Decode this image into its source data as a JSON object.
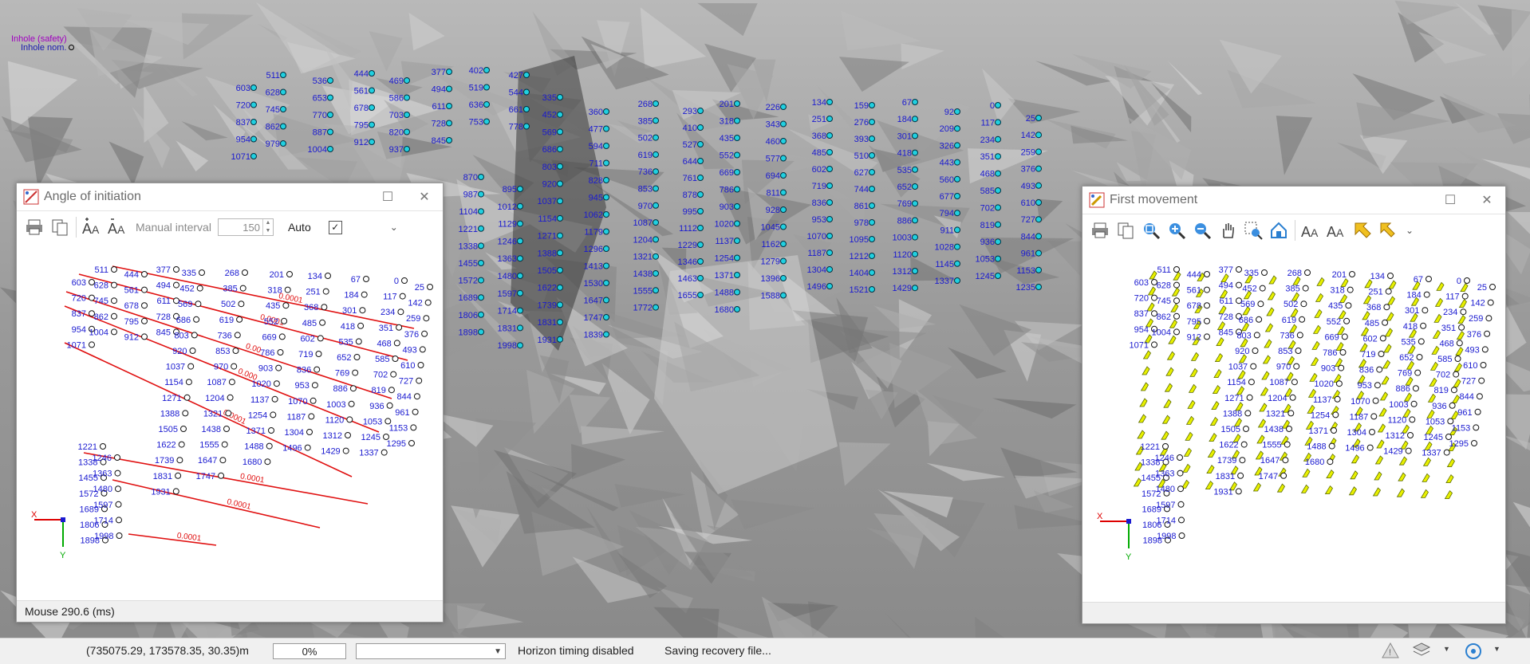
{
  "legend": {
    "line1": "Inhole (safety)",
    "line2": "Inhole nom."
  },
  "scene_labels": [
    [
      603,
      720,
      837,
      954,
      1071
    ],
    [
      511,
      628,
      745,
      862,
      979
    ],
    [
      536,
      653,
      770,
      887,
      1004
    ],
    [
      444,
      561,
      678,
      795,
      912
    ],
    [
      469,
      586,
      703,
      820,
      937
    ],
    [
      377,
      494,
      611,
      728,
      845
    ],
    [
      402,
      519,
      636,
      753
    ],
    [
      427,
      544,
      661,
      778
    ],
    [
      335,
      452,
      569,
      686,
      803,
      920,
      1037,
      1154,
      1271,
      1388,
      1505,
      1622,
      1739,
      1831,
      1931
    ],
    [
      360,
      477,
      594,
      711,
      828,
      945,
      1062,
      1179,
      1296,
      1413,
      1530,
      1647,
      1747,
      1839
    ],
    [
      268,
      385,
      502,
      619,
      736,
      853,
      970,
      1087,
      1204,
      1321,
      1438,
      1555,
      1772
    ],
    [
      293,
      410,
      527,
      644,
      761,
      878,
      995,
      1112,
      1229,
      1346,
      1463,
      1655
    ],
    [
      201,
      318,
      435,
      552,
      669,
      786,
      903,
      1020,
      1137,
      1254,
      1371,
      1488,
      1680
    ],
    [
      226,
      343,
      460,
      577,
      694,
      811,
      928,
      1045,
      1162,
      1279,
      1396,
      1588
    ],
    [
      134,
      251,
      368,
      485,
      602,
      719,
      836,
      953,
      1070,
      1187,
      1304,
      1496
    ],
    [
      159,
      276,
      393,
      510,
      627,
      744,
      861,
      978,
      1095,
      1212,
      1404,
      1521
    ],
    [
      67,
      184,
      301,
      418,
      535,
      652,
      769,
      886,
      1003,
      1120,
      1312,
      1429
    ],
    [
      92,
      209,
      326,
      443,
      560,
      677,
      794,
      911,
      1028,
      1145,
      1337
    ],
    [
      0,
      117,
      234,
      351,
      468,
      585,
      702,
      819,
      936,
      1053,
      1245
    ],
    [
      25,
      142,
      259,
      376,
      493,
      610,
      727,
      844,
      961,
      1153,
      1235
    ],
    [
      870,
      987,
      1104,
      1221,
      1338,
      1455,
      1572,
      1689,
      1806,
      1898
    ],
    [
      895,
      1012,
      1129,
      1246,
      1363,
      1480,
      1597,
      1714,
      1831,
      1998
    ]
  ],
  "angle_window": {
    "title": "Angle of initiation",
    "interval_label": "Manual interval",
    "interval_value": "150",
    "auto_label": "Auto",
    "auto_check": "✓",
    "status": "Mouse  290.6 (ms)",
    "contours": [
      "0.0001",
      "0.0001",
      "0.00",
      "0.000",
      "0.0001",
      "0.0001",
      "0.0001",
      "0.0001"
    ],
    "axis_x": "X",
    "axis_y": "Y"
  },
  "movement_window": {
    "title": "First movement",
    "axis_x": "X",
    "axis_y": "Y"
  },
  "plot_labels": [
    [
      603,
      720,
      837,
      954,
      1071
    ],
    [
      511,
      628,
      745,
      862,
      1004
    ],
    [
      444,
      561,
      678,
      795,
      912
    ],
    [
      377,
      494,
      611,
      728,
      845
    ],
    [
      335,
      452,
      569,
      686,
      803,
      920,
      1037,
      1154,
      1271,
      1388,
      1505,
      1622,
      1739,
      1831,
      1931
    ],
    [
      268,
      385,
      502,
      619,
      736,
      853,
      970,
      1087,
      1204,
      1321,
      1438,
      1555,
      1647,
      1747
    ],
    [
      201,
      318,
      435,
      552,
      669,
      786,
      903,
      1020,
      1137,
      1254,
      1371,
      1488,
      1680
    ],
    [
      134,
      251,
      368,
      485,
      602,
      719,
      836,
      953,
      1070,
      1187,
      1304,
      1496
    ],
    [
      67,
      184,
      301,
      418,
      535,
      652,
      769,
      886,
      1003,
      1120,
      1312,
      1429
    ],
    [
      0,
      117,
      234,
      351,
      468,
      585,
      702,
      819,
      936,
      1053,
      1245,
      1337
    ],
    [
      25,
      142,
      259,
      376,
      493,
      610,
      727,
      844,
      961,
      1153,
      1295
    ],
    [
      1221,
      1338,
      1455,
      1572,
      1689,
      1806,
      1898
    ],
    [
      1246,
      1363,
      1480,
      1597,
      1714,
      1998
    ]
  ],
  "statusbar": {
    "coords": "(735075.29, 173578.35, 30.35)m",
    "progress": "0%",
    "horizon": "Horizon timing disabled",
    "saving": "Saving recovery file..."
  },
  "colors": {
    "label_blue": "#1a1ad0",
    "contour_red": "#e01010",
    "hole_cyan": "#20d0e0",
    "arrow_yellow": "#e8f000"
  }
}
